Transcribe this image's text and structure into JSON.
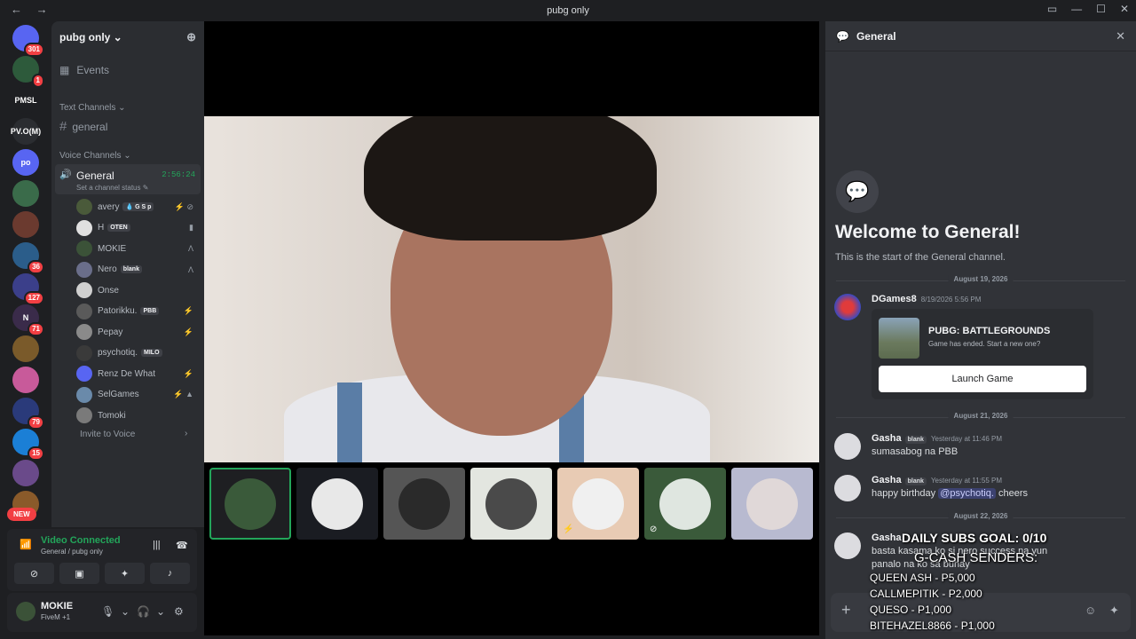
{
  "window": {
    "title": "pubg only",
    "nav_back": "←",
    "nav_forward": "→"
  },
  "guilds": [
    {
      "label": "",
      "badge": "301",
      "color": "#5865f2"
    },
    {
      "label": "",
      "badge": "1",
      "color": "#2d5a3b"
    },
    {
      "label": "PMSL",
      "badge": "",
      "color": "#1e1f22"
    },
    {
      "label": "PV.O(M)",
      "badge": "",
      "color": "#2b2d31"
    },
    {
      "label": "po",
      "badge": "",
      "color": "#5865f2"
    },
    {
      "label": "",
      "badge": "",
      "color": "#3a6b4a"
    },
    {
      "label": "",
      "badge": "",
      "color": "#6b3a2f"
    },
    {
      "label": "",
      "badge": "36",
      "color": "#2b5d8a"
    },
    {
      "label": "",
      "badge": "127",
      "color": "#3b3f8a"
    },
    {
      "label": "N",
      "badge": "71",
      "color": "#3a2b4a"
    },
    {
      "label": "",
      "badge": "",
      "color": "#7a5a2a"
    },
    {
      "label": "",
      "badge": "",
      "color": "#c85a9a"
    },
    {
      "label": "",
      "badge": "79",
      "color": "#2a3a7a"
    },
    {
      "label": "",
      "badge": "15",
      "color": "#1b7fd6"
    },
    {
      "label": "",
      "badge": "",
      "color": "#6a4a8a"
    },
    {
      "label": "",
      "badge": "",
      "color": "#8a5a2a"
    }
  ],
  "new_label": "NEW",
  "server": {
    "name": "pubg only ⌄",
    "events": "Events",
    "text_category": "Text Channels ⌄",
    "text_channel": "general",
    "voice_category": "Voice Channels ⌄",
    "voice_channel": "General",
    "voice_timer": "2:56:24",
    "voice_status": "Set a channel status ✎",
    "invite": "Invite to Voice"
  },
  "members": [
    {
      "name": "avery",
      "tag": "💧 G S p",
      "icons": "⚡ ⊘",
      "color": "#4a5a3a"
    },
    {
      "name": "H",
      "tag": "OTEN",
      "icons": "▮",
      "color": "#e0e0e0"
    },
    {
      "name": "MOKIE",
      "tag": "",
      "icons": "Λ",
      "color": "#3b5238"
    },
    {
      "name": "Nero",
      "tag": "blank",
      "icons": "Λ",
      "color": "#6a6e8a"
    },
    {
      "name": "Onse",
      "tag": "",
      "icons": "",
      "color": "#d0d0d0"
    },
    {
      "name": "Patorikku.",
      "tag": "PBB",
      "icons": "⚡",
      "color": "#5a5a5a"
    },
    {
      "name": "Pepay",
      "tag": "",
      "icons": "⚡",
      "color": "#8a8a8a"
    },
    {
      "name": "psychotiq.",
      "tag": "MILO",
      "icons": "",
      "color": "#3a3a3a"
    },
    {
      "name": "Renz De What",
      "tag": "",
      "icons": "⚡",
      "color": "#5865f2"
    },
    {
      "name": "SelGames",
      "tag": "",
      "icons": "⚡ ▲",
      "color": "#6a8aaa"
    },
    {
      "name": "Tomoki",
      "tag": "",
      "icons": "",
      "color": "#7a7a7a"
    }
  ],
  "voice_panel": {
    "status": "Video Connected",
    "sub": "General / pubg only"
  },
  "user": {
    "name": "MOKIE",
    "activity": "FiveM +1"
  },
  "participants": [
    {
      "bg": "#1e1f22",
      "circle": "#3a5a3a",
      "muted": ""
    },
    {
      "bg": "#1a1c22",
      "circle": "#e8e8e8",
      "muted": ""
    },
    {
      "bg": "#555",
      "circle": "#2a2a2a",
      "muted": ""
    },
    {
      "bg": "#e3e6e0",
      "circle": "#4a4a4a",
      "muted": ""
    },
    {
      "bg": "#e8cbb4",
      "circle": "#f0f0f0",
      "muted": "⚡"
    },
    {
      "bg": "#3a5a3a",
      "circle": "#dfe6e0",
      "muted": "⊘"
    },
    {
      "bg": "#b8bad0",
      "circle": "#e0d8d8",
      "muted": ""
    }
  ],
  "chat": {
    "channel": "General",
    "welcome_title": "Welcome to General!",
    "welcome_sub": "This is the start of the General channel.",
    "dates": [
      "August 19, 2026",
      "August 21, 2026",
      "August 22, 2026"
    ],
    "messages": [
      {
        "author": "DGames8",
        "time": "8/19/2026 5:56 PM",
        "tag": "",
        "body": ""
      },
      {
        "author": "Gasha",
        "time": "Yesterday at 11:46 PM",
        "tag": "blank",
        "body": "sumasabog na PBB"
      },
      {
        "author": "Gasha",
        "time": "Yesterday at 11:55 PM",
        "tag": "blank",
        "body_pre": "happy birthday ",
        "mention": "@psychotiq.",
        "body_post": " cheers"
      },
      {
        "author": "Gasha",
        "time": "",
        "tag": "",
        "body": "basta kasama ko si nero success na yun",
        "body2": "panalo na ko sa buhay"
      }
    ],
    "game_card": {
      "title": "PUBG: BATTLEGROUNDS",
      "sub": "Game has ended. Start a new one?",
      "button": "Launch Game"
    }
  },
  "overlay": {
    "goal": "DAILY SUBS GOAL: 0/10",
    "senders_title": "G-CASH SENDERS:",
    "senders": [
      "QUEEN ASH - P5,000",
      "CALLMEPITIK - P2,000",
      "QUESO - P1,000",
      "BITEHAZEL8866 - P1,000"
    ]
  }
}
